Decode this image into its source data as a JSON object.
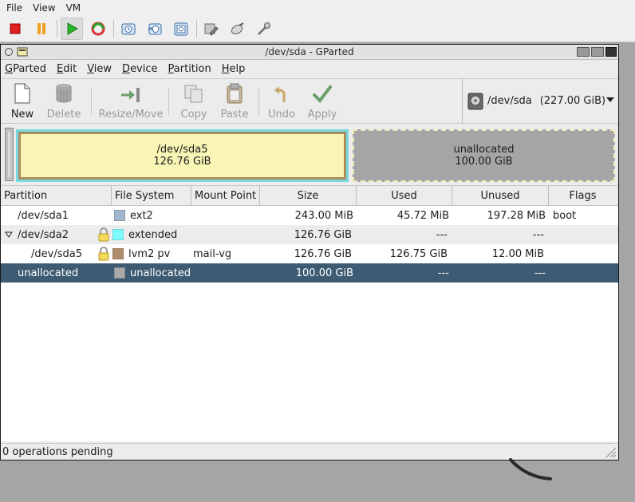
{
  "host": {
    "menu": [
      "File",
      "View",
      "VM"
    ],
    "toolbar_icons": [
      "stop-icon",
      "pause-icon",
      "play-icon",
      "reset-icon",
      "snapshot-icon",
      "snapshot-manager-icon",
      "revert-snapshot-icon",
      "settings-icon",
      "devices-icon",
      "tools-icon"
    ]
  },
  "window": {
    "title": "/dev/sda - GParted"
  },
  "menubar": {
    "items": [
      {
        "pre": "G",
        "ul": "",
        "post": "Parted"
      },
      {
        "pre": "",
        "ul": "E",
        "post": "dit"
      },
      {
        "pre": "",
        "ul": "V",
        "post": "iew"
      },
      {
        "pre": "",
        "ul": "D",
        "post": "evice"
      },
      {
        "pre": "",
        "ul": "P",
        "post": "artition"
      },
      {
        "pre": "",
        "ul": "H",
        "post": "elp"
      }
    ]
  },
  "toolbar": {
    "new": "New",
    "delete": "Delete",
    "resize": "Resize/Move",
    "copy": "Copy",
    "paste": "Paste",
    "undo": "Undo",
    "apply": "Apply"
  },
  "device": {
    "path": "/dev/sda",
    "size": "(227.00 GiB)"
  },
  "visual": {
    "sda5": {
      "name": "/dev/sda5",
      "size": "126.76 GiB",
      "share": 0.558
    },
    "unallocated": {
      "name": "unallocated",
      "size": "100.00 GiB",
      "share": 0.442
    }
  },
  "table": {
    "headers": [
      "Partition",
      "File System",
      "Mount Point",
      "Size",
      "Used",
      "Unused",
      "Flags"
    ],
    "rows": [
      {
        "partition": "/dev/sda1",
        "fs": "ext2",
        "fs_color": "#9fb6cd",
        "mount": "",
        "size": "243.00 MiB",
        "used": "45.72 MiB",
        "unused": "197.28 MiB",
        "flags": "boot",
        "locked": false
      },
      {
        "partition": "/dev/sda2",
        "fs": "extended",
        "fs_color": "#7dfcfe",
        "mount": "",
        "size": "126.76 GiB",
        "used": "---",
        "unused": "---",
        "flags": "",
        "locked": true
      },
      {
        "partition": "/dev/sda5",
        "fs": "lvm2 pv",
        "fs_color": "#b08c6a",
        "mount": "mail-vg",
        "size": "126.76 GiB",
        "used": "126.75 GiB",
        "unused": "12.00 MiB",
        "flags": "",
        "locked": true
      },
      {
        "partition": "unallocated",
        "fs": "unallocated",
        "fs_color": "#a9a9a9",
        "mount": "",
        "size": "100.00 GiB",
        "used": "---",
        "unused": "---",
        "flags": "",
        "locked": false
      }
    ]
  },
  "status": {
    "text": "0 operations pending"
  }
}
